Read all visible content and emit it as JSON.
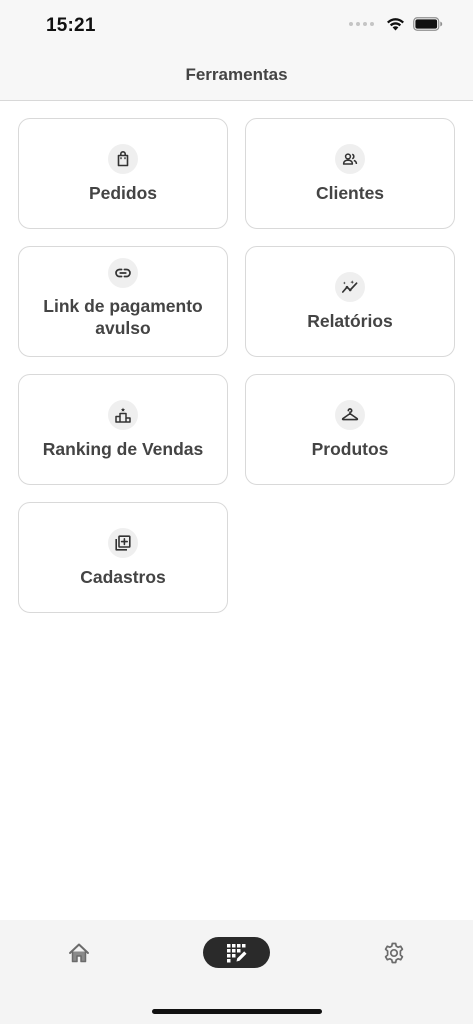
{
  "status_bar": {
    "time": "15:21"
  },
  "header": {
    "title": "Ferramentas"
  },
  "tools": [
    {
      "label": "Pedidos",
      "icon": "shopping-bag-icon"
    },
    {
      "label": "Clientes",
      "icon": "users-icon"
    },
    {
      "label": "Link de pagamento avulso",
      "icon": "link-icon"
    },
    {
      "label": "Relatórios",
      "icon": "analytics-icon"
    },
    {
      "label": "Ranking de Vendas",
      "icon": "podium-icon"
    },
    {
      "label": "Produtos",
      "icon": "hanger-icon"
    },
    {
      "label": "Cadastros",
      "icon": "add-to-library-icon"
    }
  ],
  "tab_bar": {
    "items": [
      {
        "name": "home",
        "icon": "home-icon",
        "active": false
      },
      {
        "name": "ferramentas",
        "icon": "tools-grid-icon",
        "active": true
      },
      {
        "name": "configuracoes",
        "icon": "gear-icon",
        "active": false
      }
    ]
  },
  "colors": {
    "text": "#444444",
    "card_border": "#d9d9d9",
    "active_tab_bg": "#2a2a2a",
    "background": "#ffffff",
    "bar_background": "#f7f7f7"
  }
}
